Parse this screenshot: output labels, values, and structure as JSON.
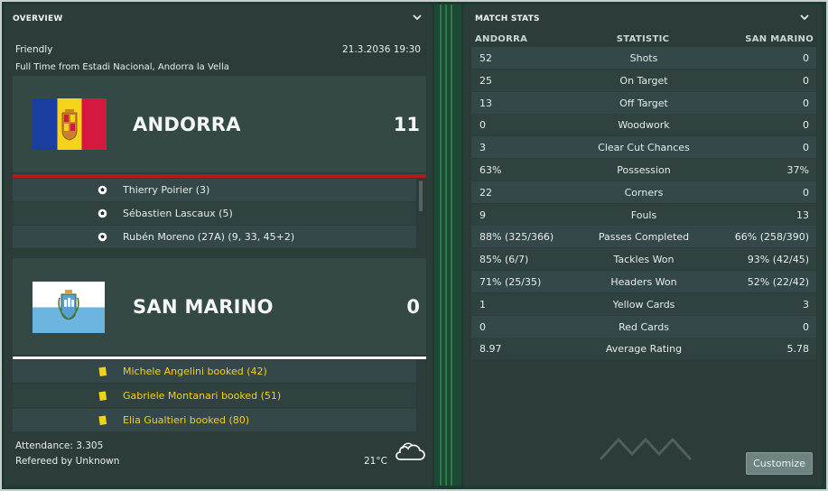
{
  "overview": {
    "title": "OVERVIEW",
    "match_type": "Friendly",
    "datetime": "21.3.2036 19:30",
    "result_line": "Full Time from Estadi Nacional, Andorra la Vella",
    "home": {
      "name": "ANDORRA",
      "score": "11",
      "bar_color": "#b31b1b",
      "flag_colors": [
        "#1b3fa0",
        "#f6d21a",
        "#d5183f"
      ],
      "events": [
        {
          "icon": "football-icon",
          "text": "Thierry Poirier (3)"
        },
        {
          "icon": "football-icon",
          "text": "Sébastien Lascaux (5)"
        },
        {
          "icon": "football-icon",
          "text": "Rubén Moreno (27A) (9, 33, 45+2)"
        }
      ]
    },
    "away": {
      "name": "SAN MARINO",
      "score": "0",
      "bar_color": "#ffffff",
      "flag_colors": [
        "#ffffff",
        "#6cb5e0"
      ],
      "events": [
        {
          "icon": "yellow-card-icon",
          "text": "Michele Angelini booked (42)"
        },
        {
          "icon": "yellow-card-icon",
          "text": "Gabriele Montanari booked (51)"
        },
        {
          "icon": "yellow-card-icon",
          "text": "Elia Gualtieri booked (80)"
        }
      ]
    },
    "attendance": "Attendance: 3.305",
    "referee": "Refereed by Unknown",
    "temperature": "21°C",
    "weather_icon": "cloudy-icon"
  },
  "stats": {
    "title": "MATCH STATS",
    "col_home": "ANDORRA",
    "col_stat": "STATISTIC",
    "col_away": "SAN MARINO",
    "rows": [
      {
        "home": "52",
        "label": "Shots",
        "away": "0"
      },
      {
        "home": "25",
        "label": "On Target",
        "away": "0"
      },
      {
        "home": "13",
        "label": "Off Target",
        "away": "0"
      },
      {
        "home": "0",
        "label": "Woodwork",
        "away": "0"
      },
      {
        "home": "3",
        "label": "Clear Cut Chances",
        "away": "0"
      },
      {
        "home": "63%",
        "label": "Possession",
        "away": "37%"
      },
      {
        "home": "22",
        "label": "Corners",
        "away": "0"
      },
      {
        "home": "9",
        "label": "Fouls",
        "away": "13"
      },
      {
        "home": "88% (325/366)",
        "label": "Passes Completed",
        "away": "66% (258/390)"
      },
      {
        "home": "85% (6/7)",
        "label": "Tackles Won",
        "away": "93% (42/45)"
      },
      {
        "home": "71% (25/35)",
        "label": "Headers Won",
        "away": "52% (22/42)"
      },
      {
        "home": "1",
        "label": "Yellow Cards",
        "away": "3"
      },
      {
        "home": "0",
        "label": "Red Cards",
        "away": "0"
      },
      {
        "home": "8.97",
        "label": "Average Rating",
        "away": "5.78"
      }
    ],
    "customize_label": "Customize"
  }
}
